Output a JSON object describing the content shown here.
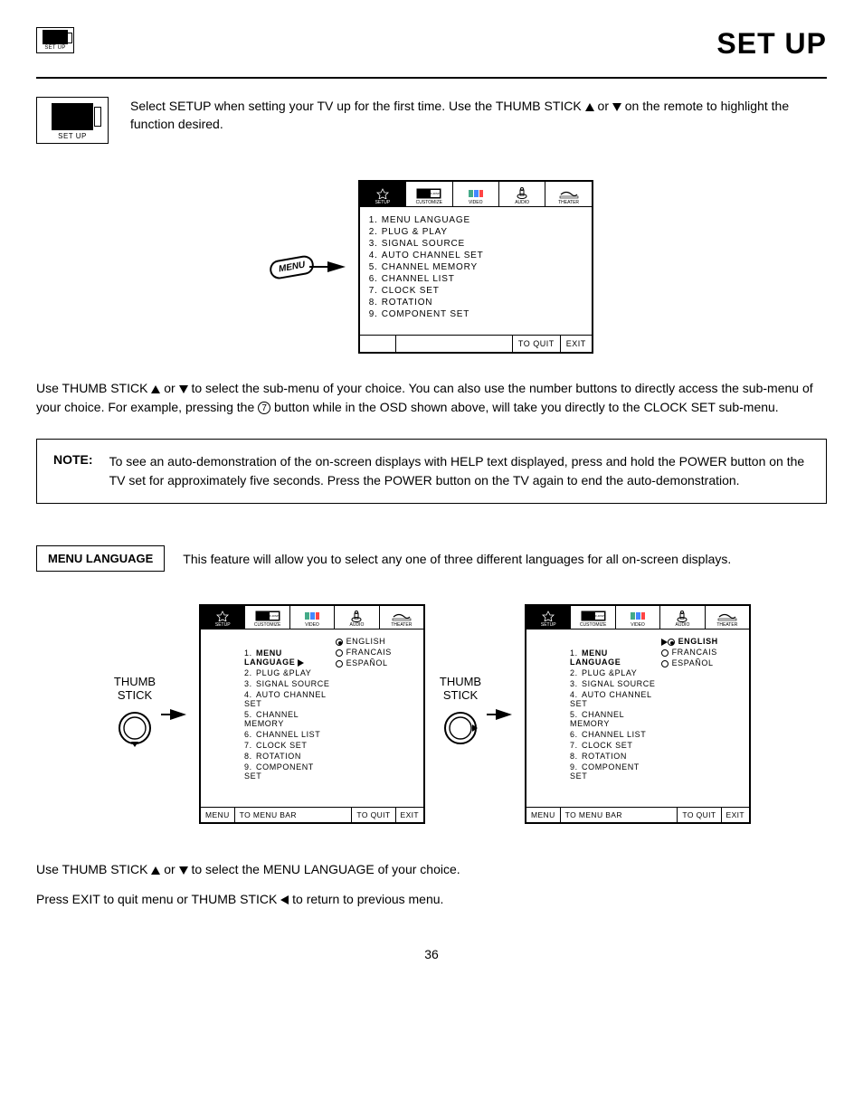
{
  "header": {
    "icon_small_label": "SET UP",
    "page_title": "SET UP"
  },
  "intro": {
    "icon_label": "SET UP",
    "text_a": "Select SETUP when setting your TV up for the first time.  Use the THUMB STICK ",
    "text_b": " or ",
    "text_c": " on the remote to highlight the function desired."
  },
  "menu_bubble": "MENU",
  "osd_tabs": [
    "SETUP",
    "CUSTOMIZE",
    "VIDEO",
    "AUDIO",
    "THEATER"
  ],
  "main_osd": {
    "items": [
      {
        "n": "1.",
        "t": "MENU LANGUAGE"
      },
      {
        "n": "2.",
        "t": "PLUG & PLAY"
      },
      {
        "n": "3.",
        "t": "SIGNAL SOURCE"
      },
      {
        "n": "4.",
        "t": "AUTO CHANNEL SET"
      },
      {
        "n": "5.",
        "t": "CHANNEL MEMORY"
      },
      {
        "n": "6.",
        "t": "CHANNEL LIST"
      },
      {
        "n": "7.",
        "t": "CLOCK SET"
      },
      {
        "n": "8.",
        "t": "ROTATION"
      },
      {
        "n": "9.",
        "t": "COMPONENT SET"
      }
    ],
    "footer_quit": "TO QUIT",
    "footer_exit": "EXIT"
  },
  "para1": {
    "a": "Use THUMB STICK ",
    "b": " or ",
    "c": " to select the sub-menu of your choice.  You can also use the number buttons to directly access the sub-menu of your choice.  For example, pressing the ",
    "circ": "7",
    "d": " button while in the OSD shown above, will take you directly to the CLOCK SET sub-menu."
  },
  "note": {
    "label": "NOTE:",
    "text": "To see an auto-demonstration of the on-screen displays with HELP text displayed, press and hold the POWER button on the TV set for approximately five seconds. Press the POWER button on the TV again to end the auto-demonstration."
  },
  "feature": {
    "box": "MENU LANGUAGE",
    "desc": "This feature will allow you to select any one of three different languages for all on-screen displays."
  },
  "thumb_label": "THUMB\nSTICK",
  "osd2_left": {
    "items": [
      {
        "n": "1.",
        "t": "MENU LANGUAGE",
        "bold": true,
        "arrow": true
      },
      {
        "n": "2.",
        "t": "PLUG &PLAY"
      },
      {
        "n": "3.",
        "t": "SIGNAL SOURCE"
      },
      {
        "n": "4.",
        "t": "AUTO CHANNEL SET"
      },
      {
        "n": "5.",
        "t": "CHANNEL MEMORY"
      },
      {
        "n": "6.",
        "t": "CHANNEL LIST"
      },
      {
        "n": "7.",
        "t": "CLOCK SET"
      },
      {
        "n": "8.",
        "t": "ROTATION"
      },
      {
        "n": "9.",
        "t": "COMPONENT SET"
      }
    ],
    "langs": [
      "ENGLISH",
      "FRANCAIS",
      "ESPAÑOL"
    ],
    "lang_sel": 0,
    "show_sel_arrow": false,
    "footer_menu": "MENU",
    "footer_bar": "TO MENU BAR",
    "footer_quit": "TO QUIT",
    "footer_exit": "EXIT"
  },
  "osd2_right": {
    "items": [
      {
        "n": "1.",
        "t": "MENU LANGUAGE",
        "bold": true
      },
      {
        "n": "2.",
        "t": "PLUG &PLAY"
      },
      {
        "n": "3.",
        "t": "SIGNAL SOURCE"
      },
      {
        "n": "4.",
        "t": "AUTO CHANNEL SET"
      },
      {
        "n": "5.",
        "t": "CHANNEL MEMORY"
      },
      {
        "n": "6.",
        "t": "CHANNEL LIST"
      },
      {
        "n": "7.",
        "t": "CLOCK SET"
      },
      {
        "n": "8.",
        "t": "ROTATION"
      },
      {
        "n": "9.",
        "t": "COMPONENT SET"
      }
    ],
    "langs": [
      "ENGLISH",
      "FRANCAIS",
      "ESPAÑOL"
    ],
    "lang_sel": 0,
    "lang_bold": 0,
    "show_sel_arrow": true,
    "footer_menu": "MENU",
    "footer_bar": "TO MENU BAR",
    "footer_quit": "TO QUIT",
    "footer_exit": "EXIT"
  },
  "closing1": {
    "a": "Use THUMB STICK ",
    "b": " or ",
    "c": " to select the MENU LANGUAGE of your choice."
  },
  "closing2": {
    "a": "Press EXIT to quit menu or THUMB STICK ",
    "b": " to return to previous menu."
  },
  "page_number": "36"
}
